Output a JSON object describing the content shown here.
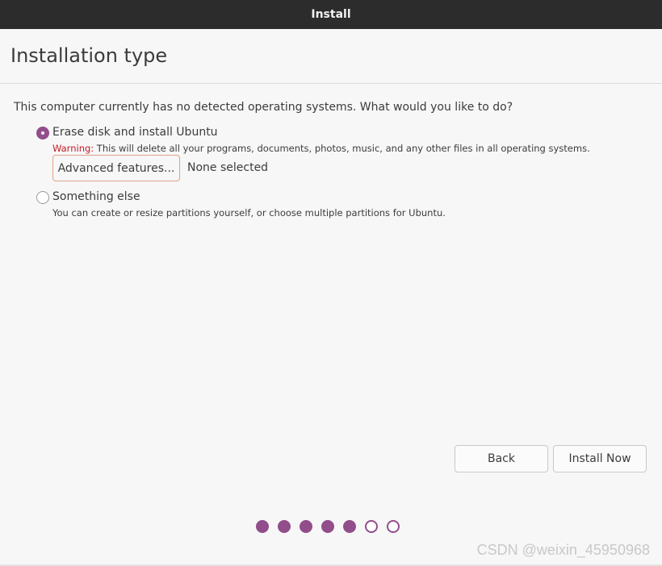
{
  "window": {
    "title": "Install"
  },
  "page": {
    "title": "Installation type",
    "question": "This computer currently has no detected operating systems. What would you like to do?"
  },
  "options": [
    {
      "label": "Erase disk and install Ubuntu",
      "selected": true,
      "warning_label": "Warning:",
      "description": " This will delete all your programs, documents, photos, music, and any other files in all operating systems.",
      "advanced_button": "Advanced features...",
      "advanced_status": "None selected"
    },
    {
      "label": "Something else",
      "selected": false,
      "description": "You can create or resize partitions yourself, or choose multiple partitions for Ubuntu."
    }
  ],
  "buttons": {
    "back": "Back",
    "install_now": "Install Now"
  },
  "progress": {
    "total_steps": 7,
    "completed_steps": 5
  },
  "watermark": "CSDN @weixin_45950968",
  "colors": {
    "accent": "#924d8b",
    "warning": "#c01c28",
    "titlebar": "#2c2c2c"
  }
}
